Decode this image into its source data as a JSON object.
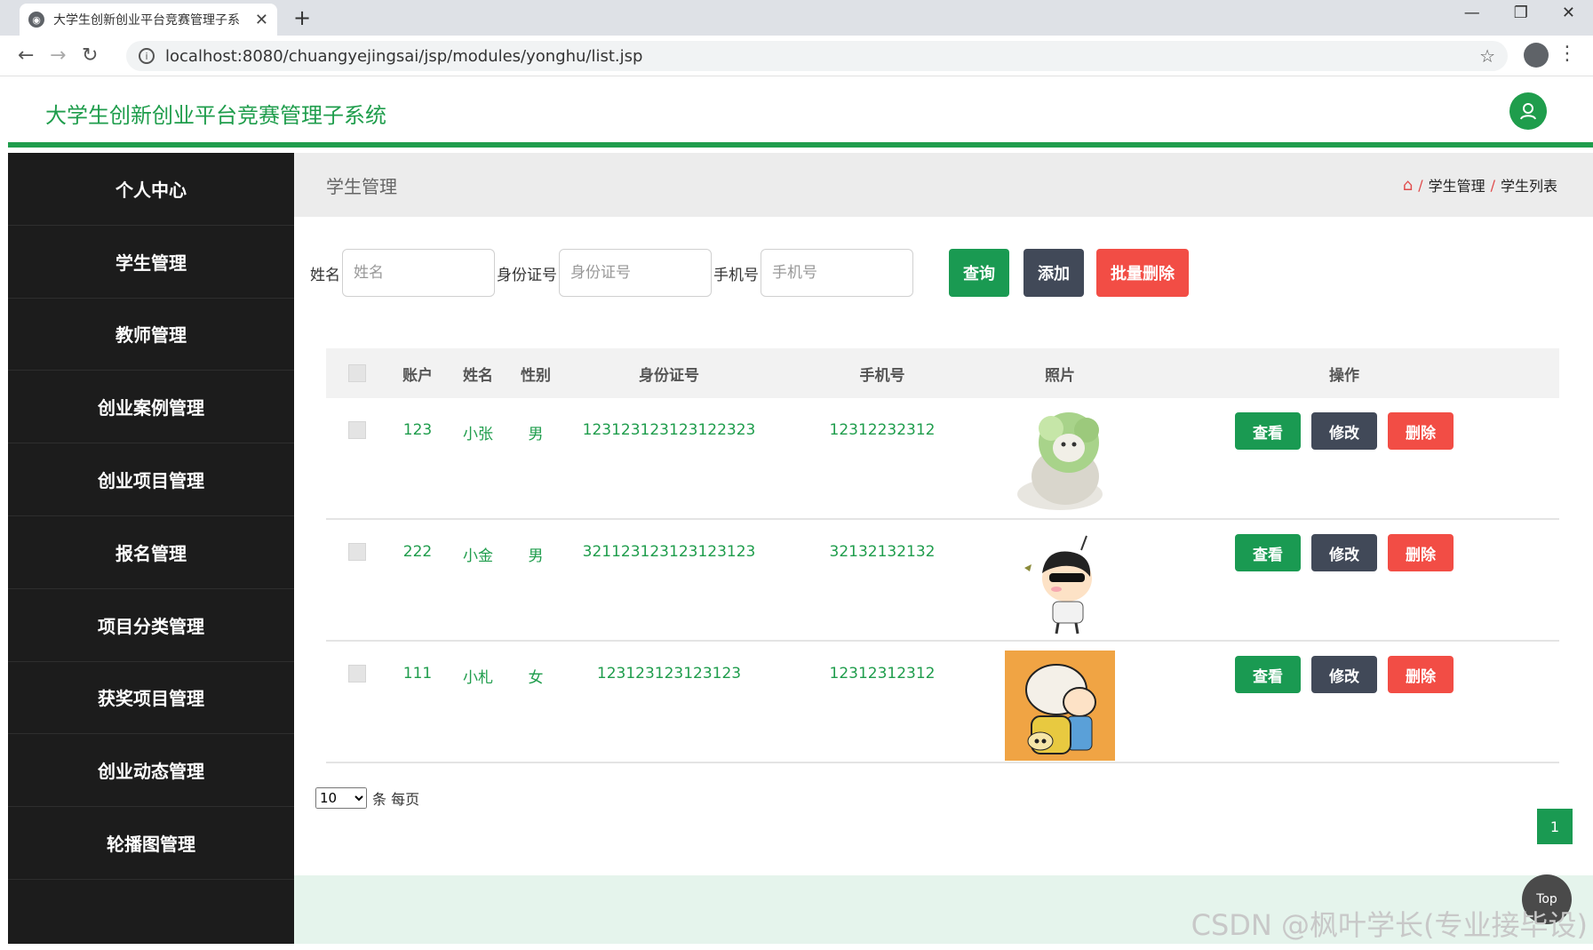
{
  "browser": {
    "tab_title": "大学生创新创业平台竞赛管理子系",
    "url": "localhost:8080/chuangyejingsai/jsp/modules/yonghu/list.jsp"
  },
  "app": {
    "title": "大学生创新创业平台竞赛管理子系统"
  },
  "sidebar": {
    "items": [
      "个人中心",
      "学生管理",
      "教师管理",
      "创业案例管理",
      "创业项目管理",
      "报名管理",
      "项目分类管理",
      "获奖项目管理",
      "创业动态管理",
      "轮播图管理"
    ]
  },
  "breadcrumb": {
    "title": "学生管理",
    "level1": "学生管理",
    "level2": "学生列表"
  },
  "search": {
    "name_label": "姓名",
    "name_placeholder": "姓名",
    "id_label": "身份证号",
    "id_placeholder": "身份证号",
    "phone_label": "手机号",
    "phone_placeholder": "手机号",
    "query_btn": "查询",
    "add_btn": "添加",
    "batch_delete_btn": "批量删除"
  },
  "table": {
    "headers": [
      "账户",
      "姓名",
      "性别",
      "身份证号",
      "手机号",
      "照片",
      "操作"
    ],
    "rows": [
      {
        "account": "123",
        "name": "小张",
        "sex": "男",
        "id": "123123123123122323",
        "phone": "12312232312",
        "photo": "cabbage-dog"
      },
      {
        "account": "222",
        "name": "小金",
        "sex": "男",
        "id": "321123123123123123",
        "phone": "32132132132",
        "photo": "cartoon-boy-sunglasses"
      },
      {
        "account": "111",
        "name": "小札",
        "sex": "女",
        "id": "123123123123123",
        "phone": "12312312312",
        "photo": "cartoon-boy-cap"
      }
    ],
    "view_btn": "查看",
    "edit_btn": "修改",
    "delete_btn": "删除"
  },
  "pagination": {
    "page_size": "10",
    "per_page_text": "条 每页",
    "current_page": "1"
  },
  "top_btn": "Top",
  "watermark": "CSDN @枫叶学长(专业接毕设)",
  "colors": {
    "accent": "#1f9d4c",
    "dark": "#414958",
    "danger": "#f24d45",
    "sidebar": "#1c1c1c"
  }
}
